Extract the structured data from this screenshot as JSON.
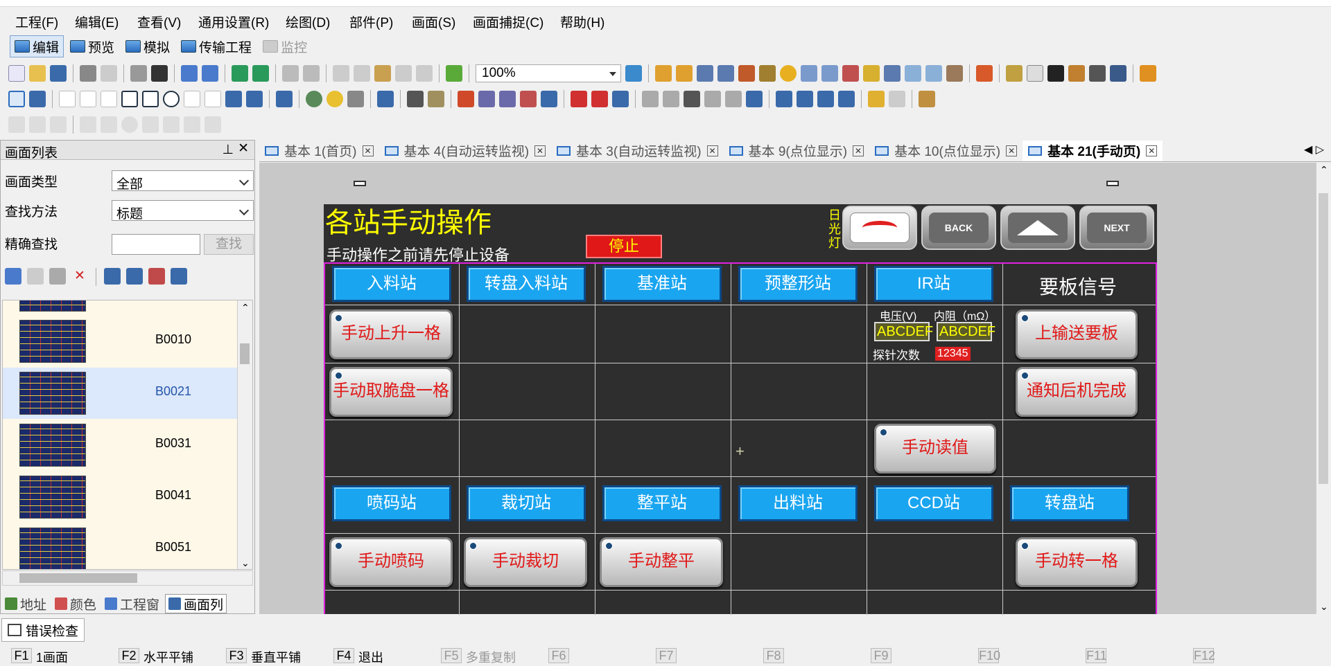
{
  "menu": [
    "工程(F)",
    "编辑(E)",
    "查看(V)",
    "通用设置(R)",
    "绘图(D)",
    "部件(P)",
    "画面(S)",
    "画面捕捉(C)",
    "帮助(H)"
  ],
  "modes": [
    "编辑",
    "预览",
    "模拟",
    "传输工程",
    "监控"
  ],
  "zoom": "100%",
  "left_panel": {
    "title": "画面列表",
    "type_label": "画面类型",
    "type_value": "全部",
    "method_label": "查找方法",
    "method_value": "标题",
    "exact_label": "精确查找",
    "search_button": "查找",
    "items": [
      "B0010",
      "B0021",
      "B0031",
      "B0041",
      "B0051"
    ],
    "tabs": [
      "地址",
      "颜色",
      "工程窗",
      "画面列"
    ]
  },
  "doc_tabs": [
    "基本 1(首页)",
    "基本 4(自动运转监视)",
    "基本 3(自动运转监视)",
    "基本 9(点位显示)",
    "基本 10(点位显示)",
    "基本 21(手动页)"
  ],
  "hmi": {
    "title": "各站手动操作",
    "subtitle": "手动操作之前请先停止设备",
    "stop": "停止",
    "light_label": "日光灯",
    "back": "BACK",
    "next": "NEXT",
    "row1": [
      "入料站",
      "转盘入料站",
      "基准站",
      "预整形站",
      "IR站"
    ],
    "signal_header": "要板信号",
    "btn_up": "手动上升一格",
    "btn_take": "手动取脆盘一格",
    "voltage_label": "电压(V)",
    "resist_label": "内阻（mΩ）",
    "val1": "ABCDEF",
    "val2": "ABCDEF",
    "probe_label": "探针次数",
    "probe_val": "12345",
    "btn_upper": "上输送要板",
    "btn_notify": "通知后机完成",
    "btn_read": "手动读值",
    "row2": [
      "喷码站",
      "裁切站",
      "整平站",
      "出料站",
      "CCD站",
      "转盘站"
    ],
    "row3": [
      "手动喷码",
      "手动裁切",
      "手动整平",
      "手动转一格"
    ]
  },
  "error_tab": "错误检查",
  "fkeys": [
    {
      "k": "F1",
      "l": "1画面"
    },
    {
      "k": "F2",
      "l": "水平平铺"
    },
    {
      "k": "F3",
      "l": "垂直平铺"
    },
    {
      "k": "F4",
      "l": "退出"
    },
    {
      "k": "F5",
      "l": "多重复制"
    },
    {
      "k": "F6",
      "l": ""
    },
    {
      "k": "F7",
      "l": ""
    },
    {
      "k": "F8",
      "l": ""
    },
    {
      "k": "F9",
      "l": ""
    },
    {
      "k": "F10",
      "l": ""
    },
    {
      "k": "F11",
      "l": ""
    },
    {
      "k": "F12",
      "l": ""
    }
  ]
}
